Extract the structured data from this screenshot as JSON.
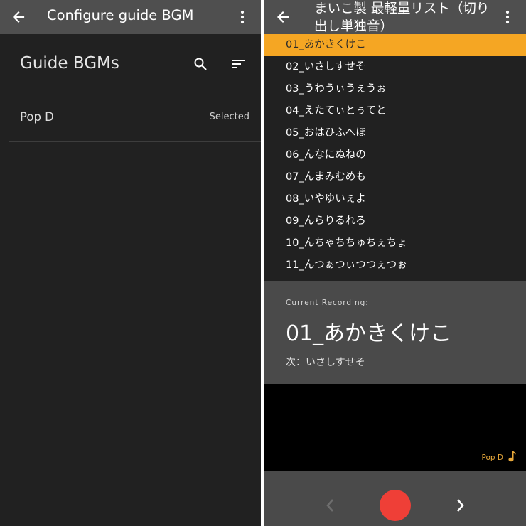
{
  "left_screen": {
    "appbar": {
      "title": "Configure guide BGM",
      "back_icon": "arrow-back-icon",
      "menu_icon": "more-vert-icon"
    },
    "section": {
      "title": "Guide BGMs",
      "search_icon": "search-icon",
      "sort_icon": "sort-icon"
    },
    "bgm_list": [
      {
        "name": "Pop D",
        "status": "Selected"
      }
    ]
  },
  "right_screen": {
    "appbar": {
      "title": "まいこ製 最軽量リスト（切り出し単独音）",
      "back_icon": "arrow-back-icon",
      "menu_icon": "more-vert-icon"
    },
    "song_list": [
      "01_あかきくけこ",
      "02_いさしすせそ",
      "03_うわうぃうぇうぉ",
      "04_えたてぃとぅてと",
      "05_おはひふへほ",
      "06_んなにぬねの",
      "07_んまみむめも",
      "08_いやゆいぇよ",
      "09_んらりるれろ",
      "10_んちゃちちゅちぇちょ",
      "11_んつぁつぃつつぇつぉ"
    ],
    "selected_index": 0,
    "recording": {
      "label": "Current Recording:",
      "current": "01_あかきくけこ",
      "next": "次：いさしすせそ"
    },
    "bgm_indicator": {
      "label": "Pop D",
      "icon": "music-note-icon"
    },
    "controls": {
      "prev_icon": "chevron-left-icon",
      "record_icon": "record-button",
      "next_icon": "chevron-right-icon"
    }
  },
  "colors": {
    "appbar": "#4f4f4f",
    "background": "#212121",
    "selected_row": "#f5a623",
    "panel": "#4a4a4a",
    "record": "#ef3f37",
    "bgm_accent": "#e8a83a"
  }
}
